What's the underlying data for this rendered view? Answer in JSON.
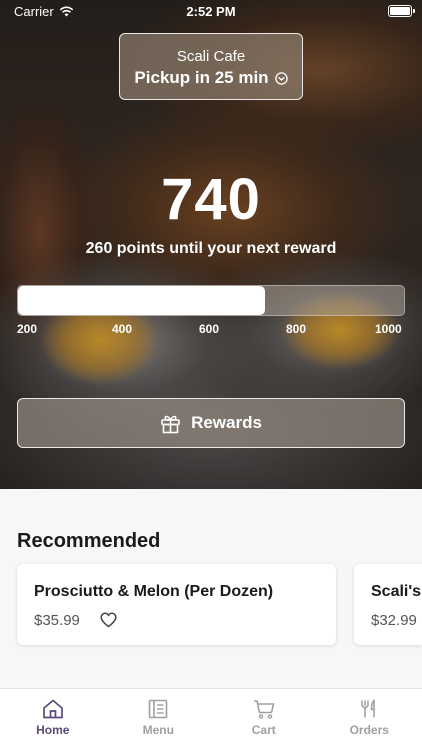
{
  "status_bar": {
    "carrier": "Carrier",
    "time": "2:52 PM"
  },
  "cafe": {
    "name": "Scali Cafe",
    "pickup": "Pickup in 25 min"
  },
  "points": {
    "value": "740",
    "subtitle": "260 points until your next reward",
    "progress_fraction": 0.64,
    "ticks": [
      "200",
      "400",
      "600",
      "800",
      "1000"
    ]
  },
  "rewards_button": {
    "label": "Rewards"
  },
  "recommended": {
    "title": "Recommended",
    "items": [
      {
        "name": "Prosciutto & Melon (Per Dozen)",
        "price": "$35.99"
      },
      {
        "name": "Scali's",
        "price": "$32.99"
      }
    ]
  },
  "tabs": [
    {
      "label": "Home",
      "icon": "home-icon",
      "active": true
    },
    {
      "label": "Menu",
      "icon": "menu-icon",
      "active": false
    },
    {
      "label": "Cart",
      "icon": "cart-icon",
      "active": false
    },
    {
      "label": "Orders",
      "icon": "orders-icon",
      "active": false
    }
  ],
  "colors": {
    "accent": "#5a4a78",
    "inactive_tab": "#a0a0a0"
  }
}
